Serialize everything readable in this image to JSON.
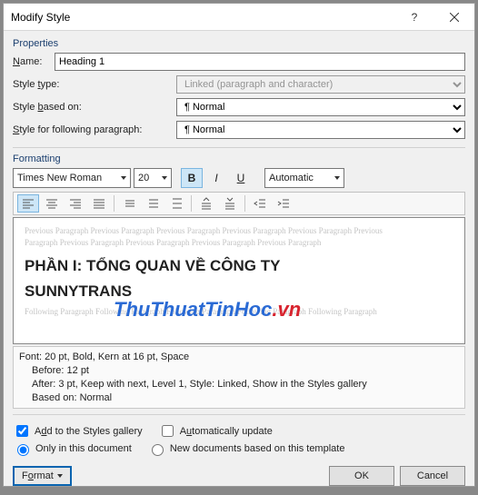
{
  "titlebar": {
    "title": "Modify Style"
  },
  "sections": {
    "properties": "Properties",
    "formatting": "Formatting"
  },
  "labels": {
    "name": "Name:",
    "style_type": "Style type:",
    "based_on": "Style based on:",
    "following": "Style for following paragraph:"
  },
  "fields": {
    "name": "Heading 1",
    "style_type": "Linked (paragraph and character)",
    "based_on": "Normal",
    "following": "Normal"
  },
  "font": {
    "name": "Times New Roman",
    "size": "20",
    "color_label": "Automatic"
  },
  "preview": {
    "ghost_before_1": "Previous Paragraph Previous Paragraph Previous Paragraph Previous Paragraph Previous Paragraph Previous",
    "ghost_before_2": "Paragraph Previous Paragraph Previous Paragraph Previous Paragraph Previous Paragraph",
    "heading_line1": "PHẦN I: TỔNG QUAN VỀ CÔNG TY",
    "heading_line2": "SUNNYTRANS",
    "ghost_after_1": "Following Paragraph Following Paragraph Following Paragraph Following Paragraph Following Paragraph"
  },
  "watermark": {
    "main": "ThuThuatTinHoc",
    "suffix": ".vn"
  },
  "description": {
    "l1": "Font: 20 pt, Bold, Kern at 16 pt, Space",
    "l2": "Before:  12 pt",
    "l3": "After:  3 pt, Keep with next, Level 1, Style: Linked, Show in the Styles gallery",
    "l4": "Based on: Normal"
  },
  "checks": {
    "add_gallery": "Add to the Styles gallery",
    "auto_update": "Automatically update",
    "only_doc": "Only in this document",
    "new_docs": "New documents based on this template"
  },
  "buttons": {
    "format": "Format",
    "ok": "OK",
    "cancel": "Cancel"
  }
}
